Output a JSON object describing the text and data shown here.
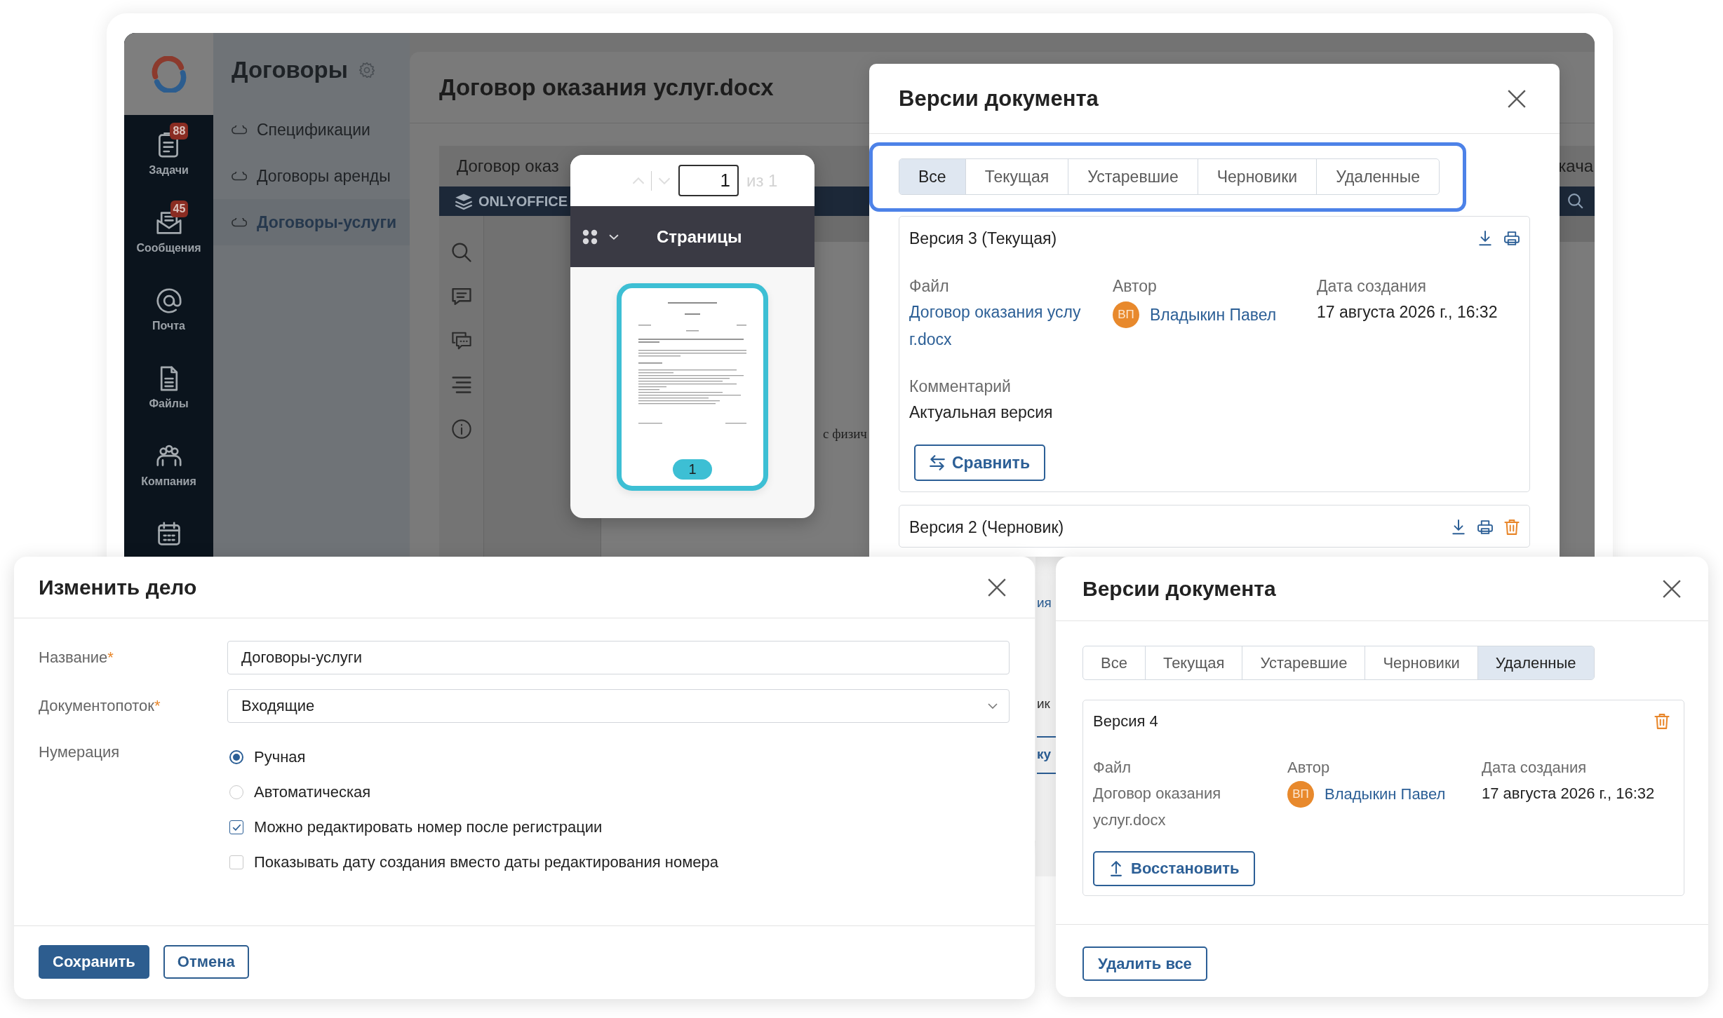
{
  "app": {
    "sidebar": {
      "items": [
        {
          "kind": "tasks",
          "label": "Задачи",
          "badge": "88"
        },
        {
          "kind": "messages",
          "label": "Сообщения",
          "badge": "45"
        },
        {
          "kind": "mail",
          "label": "Почта"
        },
        {
          "kind": "files",
          "label": "Файлы"
        },
        {
          "kind": "company",
          "label": "Компания"
        },
        {
          "kind": "calendar"
        }
      ]
    },
    "nav": {
      "title": "Договоры",
      "items": [
        {
          "label": "Спецификации",
          "selected": false
        },
        {
          "label": "Договоры аренды",
          "selected": false
        },
        {
          "label": "Договоры-услуги",
          "selected": true
        }
      ]
    },
    "document": {
      "title": "Договор оказания услуг.docx",
      "editor": {
        "title": "Договор оказ",
        "title_right": "кача",
        "brand": "ONLYOFFICE",
        "page_text": "с физич"
      }
    }
  },
  "pages_panel": {
    "page": "1",
    "page_total": "из 1",
    "title": "Страницы",
    "thumbnails": [
      {
        "number": "1",
        "selected": true
      }
    ]
  },
  "versions_dialog": {
    "title": "Версии документа",
    "tabs_highlighted": true,
    "tabs": [
      {
        "label": "Все",
        "selected": true
      },
      {
        "label": "Текущая",
        "selected": false
      },
      {
        "label": "Устаревшие",
        "selected": false
      },
      {
        "label": "Черновики",
        "selected": false
      },
      {
        "label": "Удаленные",
        "selected": false
      }
    ],
    "versions": [
      {
        "title": "Версия 3 (Текущая)",
        "download": true,
        "print": true,
        "delete": false,
        "file_label": "Файл",
        "file": "Договор оказания услуг.docx",
        "file_link": true,
        "author_label": "Автор",
        "author_initials": "ВП",
        "author": "Владыкин Павел",
        "date_label": "Дата создания",
        "date": "17 августа 2026 г., 16:32",
        "comment_label": "Комментарий",
        "comment": "Актуальная версия",
        "action": {
          "kind": "compare",
          "label": "Сравнить"
        }
      },
      {
        "title": "Версия 2 (Черновик)",
        "download": true,
        "print": true,
        "delete": true
      }
    ]
  },
  "edit_dialog": {
    "title": "Изменить дело",
    "fields": [
      {
        "kind": "text",
        "label": "Название",
        "required_mark": "*",
        "value": "Договоры-услуги"
      },
      {
        "kind": "select",
        "label": "Документопоток",
        "required_mark": "*",
        "value": "Входящие"
      },
      {
        "kind": "options",
        "label": "Нумерация",
        "options": [
          {
            "kind": "radio",
            "label": "Ручная",
            "selected": true
          },
          {
            "kind": "radio",
            "label": "Автоматическая",
            "selected": false
          },
          {
            "kind": "checkbox",
            "label": "Можно редактировать номер после регистрации",
            "checked": true
          },
          {
            "kind": "checkbox",
            "label": "Показывать дату создания вместо даты редактирования номера",
            "checked": false
          }
        ]
      }
    ],
    "buttons": [
      {
        "kind": "primary",
        "label": "Сохранить"
      },
      {
        "kind": "secondary",
        "label": "Отмена"
      }
    ]
  },
  "deleted_versions_dialog": {
    "title": "Версии документа",
    "tabs": [
      {
        "label": "Все",
        "selected": false
      },
      {
        "label": "Текущая",
        "selected": false
      },
      {
        "label": "Устаревшие",
        "selected": false
      },
      {
        "label": "Черновики",
        "selected": false
      },
      {
        "label": "Удаленные",
        "selected": true
      }
    ],
    "versions": [
      {
        "title": "Версия 4",
        "download": false,
        "print": false,
        "delete": true,
        "file_label": "Файл",
        "file": "Договор оказания услуг.docx",
        "file_link": false,
        "author_label": "Автор",
        "author_initials": "ВП",
        "author": "Владыкин Павел",
        "date_label": "Дата создания",
        "date": "17 августа 2026 г., 16:32",
        "action": {
          "kind": "restore",
          "label": "Восстановить"
        }
      }
    ],
    "footer_button": "Удалить все"
  },
  "backdrop_fragments": [
    {
      "kind": "link",
      "text": "ия"
    },
    {
      "kind": "plain",
      "text": "ик"
    },
    {
      "kind": "link",
      "text": "ку"
    }
  ]
}
